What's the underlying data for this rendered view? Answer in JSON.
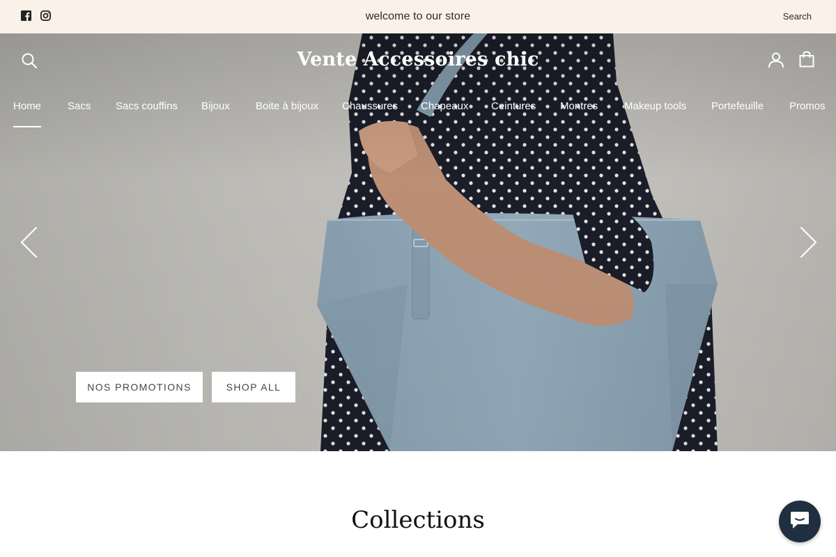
{
  "announcement": {
    "text": "welcome to our store",
    "search_label": "Search",
    "social": [
      "facebook-icon",
      "instagram-icon"
    ]
  },
  "header": {
    "logo": "Vente Accessoires chic",
    "icons": [
      "search-icon",
      "account-icon",
      "cart-icon"
    ]
  },
  "nav": {
    "items": [
      {
        "label": "Home",
        "active": true
      },
      {
        "label": "Sacs"
      },
      {
        "label": "Sacs couffins"
      },
      {
        "label": "Bijoux"
      },
      {
        "label": "Boite à bijoux"
      },
      {
        "label": "Chaussures"
      },
      {
        "label": "Chapeaux"
      },
      {
        "label": "Ceintures"
      },
      {
        "label": "Montres"
      },
      {
        "label": "Makeup tools"
      },
      {
        "label": "Portefeuille"
      },
      {
        "label": "Promos"
      }
    ]
  },
  "hero": {
    "buttons": {
      "promotions": "NOS PROMOTIONS",
      "shop_all": "SHOP ALL"
    },
    "arrows": [
      "chevron-left-icon",
      "chevron-right-icon"
    ]
  },
  "collections": {
    "title": "Collections"
  },
  "chat": {
    "icon": "chat-icon"
  },
  "colors": {
    "announcement_bg": "#faf2e8",
    "chat_bg": "#1f2f3f",
    "bag": "#97afc0",
    "blouse": "#1c1f2b"
  }
}
